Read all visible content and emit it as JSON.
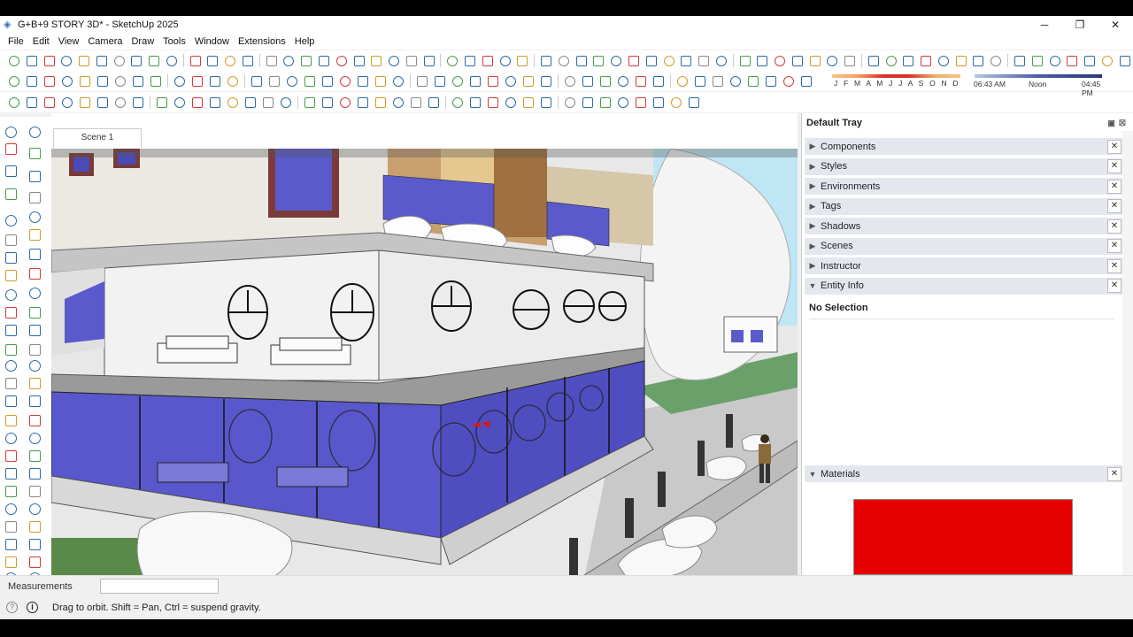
{
  "window": {
    "title": "G+B+9 STORY 3D* - SketchUp 2025",
    "minimize": "─",
    "restore": "❐",
    "close": "✕"
  },
  "menu": [
    "File",
    "Edit",
    "View",
    "Camera",
    "Draw",
    "Tools",
    "Window",
    "Extensions",
    "Help"
  ],
  "shadow_settings": {
    "months": "J F M A M J J A S O N D",
    "time_start": "06:43 AM",
    "time_mid": "Noon",
    "time_end": "04:45 PM"
  },
  "viewport": {
    "scene_tab": "Scene 1"
  },
  "tray": {
    "title": "Default Tray",
    "panels": [
      {
        "label": "Components",
        "expanded": false
      },
      {
        "label": "Styles",
        "expanded": false
      },
      {
        "label": "Environments",
        "expanded": false
      },
      {
        "label": "Tags",
        "expanded": false
      },
      {
        "label": "Shadows",
        "expanded": false
      },
      {
        "label": "Scenes",
        "expanded": false
      },
      {
        "label": "Instructor",
        "expanded": false
      },
      {
        "label": "Entity Info",
        "expanded": true
      }
    ],
    "entity_info_text": "No Selection",
    "materials_label": "Materials",
    "material_color": "#e60000"
  },
  "measurements": {
    "label": "Measurements",
    "value": ""
  },
  "status": {
    "text": "Drag to orbit. Shift = Pan, Ctrl = suspend gravity."
  },
  "icons": {
    "app": "sketchup-logo-icon",
    "close_panel": "close-icon",
    "chevron": "chevron-right-icon",
    "info": "info-icon",
    "help": "question-icon"
  }
}
